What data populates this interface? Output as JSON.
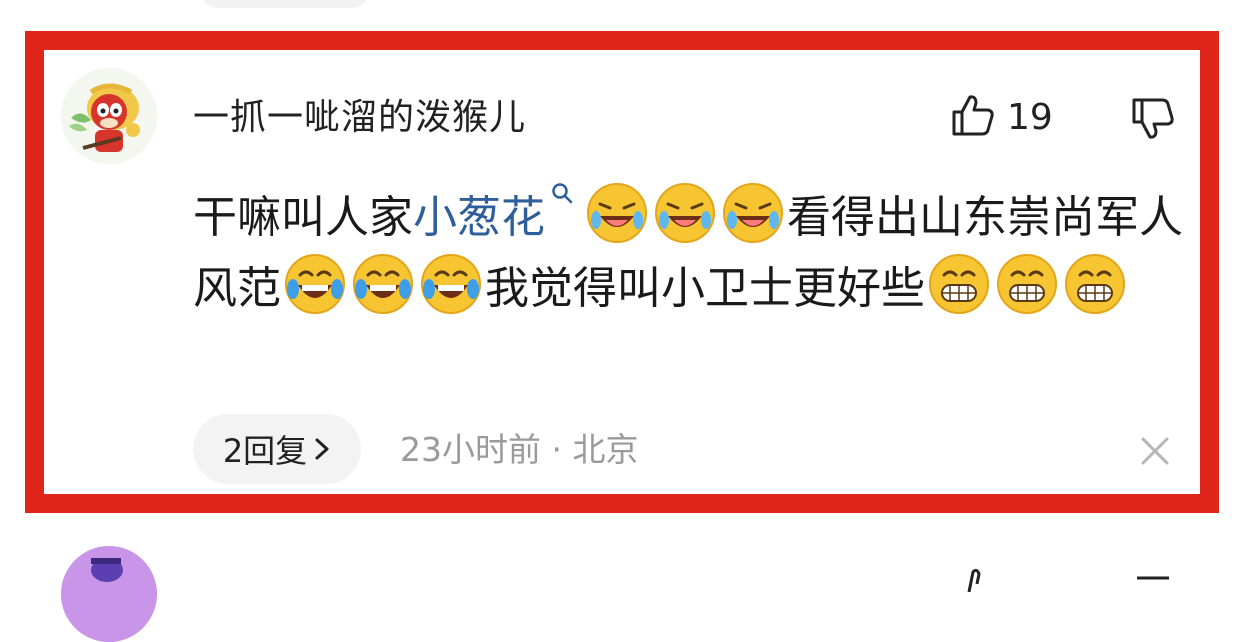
{
  "comment": {
    "username": "一抓一呲溜的泼猴儿",
    "like_count": "19",
    "text_part1": "干嘛叫人家",
    "link_text": "小葱花",
    "text_part2": "看得出山东崇尚军人风范",
    "text_part3": "我觉得叫小卫士更好些",
    "emoji_group1": [
      "rolling-laugh-emoji",
      "rolling-laugh-emoji",
      "rolling-laugh-emoji"
    ],
    "emoji_group2": [
      "tears-of-joy-emoji",
      "tears-of-joy-emoji",
      "tears-of-joy-emoji"
    ],
    "emoji_group3": [
      "grinning-emoji",
      "grinning-emoji",
      "grinning-emoji"
    ],
    "reply_label": "2回复",
    "meta_text": "23小时前 · 北京"
  },
  "colors": {
    "highlight_border": "#e0261b",
    "link": "#2f5f9b",
    "meta": "#9a9a9a"
  }
}
